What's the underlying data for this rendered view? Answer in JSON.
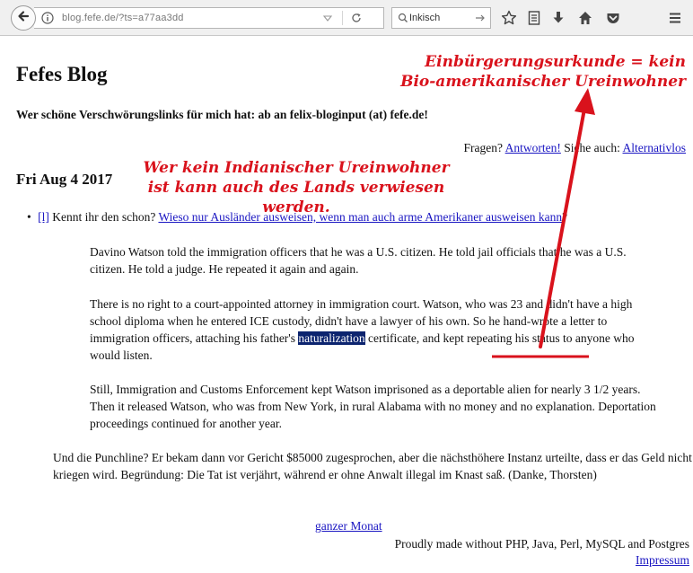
{
  "browser": {
    "url": "blog.fefe.de/?ts=a77aa3dd",
    "search_text": "Inkisch"
  },
  "page": {
    "title": "Fefes Blog",
    "tagline": "Wer schöne Verschwörungslinks für mich hat: ab an felix-bloginput (at) fefe.de!",
    "qa_prefix": "Fragen?",
    "qa_link": "Antworten!",
    "see_also_prefix": "Siehe auch:",
    "see_also_link": "Alternativlos",
    "date": "Fri Aug 4 2017"
  },
  "entry": {
    "permalink": "[l]",
    "intro": "Kennt ihr den schon?",
    "headline_link": "Wieso nur Ausländer ausweisen, wenn man auch arme Amerikaner ausweisen kann",
    "headline_suffix": "?",
    "quote_1": "Davino Watson told the immigration officers that he was a U.S. citizen. He told jail officials that he was a U.S. citizen. He told a judge. He repeated it again and again.",
    "quote_2_before": "There is no right to a court-appointed attorney in immigration court. Watson, who was 23 and didn't have a high school diploma when he entered ICE custody, didn't have a lawyer of his own. So he hand-wrote a letter to immigration officers, attaching his father's ",
    "quote_2_highlight": "naturalization",
    "quote_2_after": " certificate, and kept repeating his status to anyone who would listen.",
    "quote_3": "Still, Immigration and Customs Enforcement kept Watson imprisoned as a deportable alien for nearly 3 1/2 years. Then it released Watson, who was from New York, in rural Alabama with no money and no explanation. Deportation proceedings continued for another year.",
    "punchline": "Und die Punchline? Er bekam dann vor Gericht $85000 zugesprochen, aber die nächsthöhere Instanz urteilte, dass er das Geld nicht kriegen wird. Begründung: Die Tat ist verjährt, während er ohne Anwalt illegal im Knast saß. (Danke, Thorsten)"
  },
  "footer": {
    "month_link": "ganzer Monat",
    "made_with": "Proudly made without PHP, Java, Perl, MySQL and Postgres",
    "impressum": "Impressum"
  },
  "annotations": {
    "note_1": "Einbürgerungsurkunde = kein Bio-amerikanischer Ureinwohner",
    "note_2": "Wer kein Indianischer Ureinwohner ist kann auch des Lands verwiesen werden.",
    "color": "#d9121c"
  },
  "colors": {
    "link": "#1a16c2",
    "highlight_bg": "#0c246f",
    "toolbar_bg": "#f0f0f0"
  }
}
